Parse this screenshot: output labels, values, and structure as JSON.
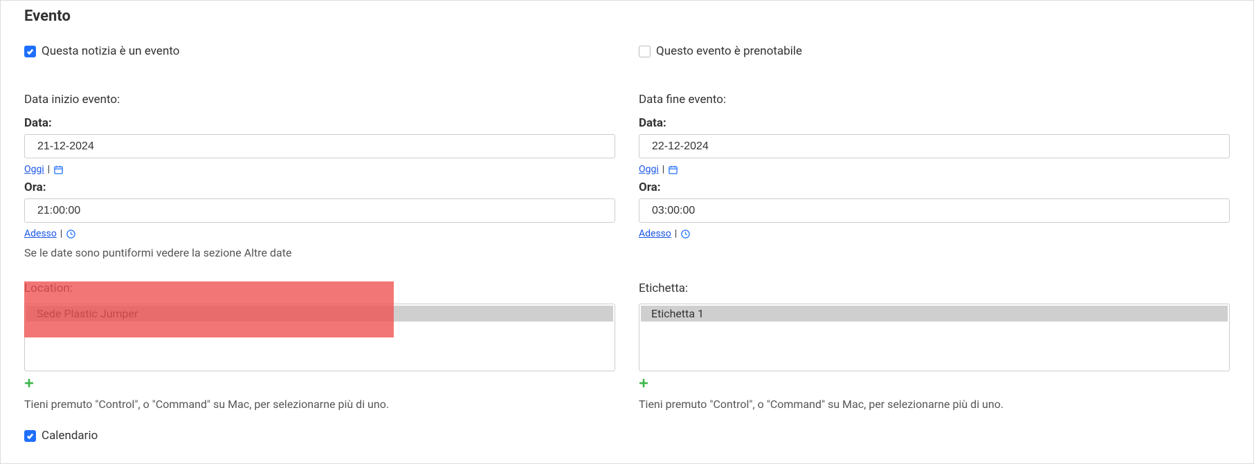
{
  "section_title": "Evento",
  "checkboxes": {
    "is_event_label": "Questa notizia è un evento",
    "is_bookable_label": "Questo evento è prenotabile",
    "calendar_label": "Calendario"
  },
  "start": {
    "header": "Data inizio evento:",
    "date_label": "Data:",
    "date_value": "21-12-2024",
    "today_link": "Oggi",
    "time_label": "Ora:",
    "time_value": "21:00:00",
    "now_link": "Adesso",
    "hint": "Se le date sono puntiformi vedere la sezione Altre date"
  },
  "end": {
    "header": "Data fine evento:",
    "date_label": "Data:",
    "date_value": "22-12-2024",
    "today_link": "Oggi",
    "time_label": "Ora:",
    "time_value": "03:00:00",
    "now_link": "Adesso"
  },
  "location": {
    "label": "Location:",
    "options": [
      "Sede Plastic Jumper"
    ],
    "multi_hint": "Tieni premuto \"Control\", o \"Command\" su Mac, per selezionarne più di uno."
  },
  "etichetta": {
    "label": "Etichetta:",
    "options": [
      "Etichetta 1"
    ],
    "multi_hint": "Tieni premuto \"Control\", o \"Command\" su Mac, per selezionarne più di uno."
  }
}
